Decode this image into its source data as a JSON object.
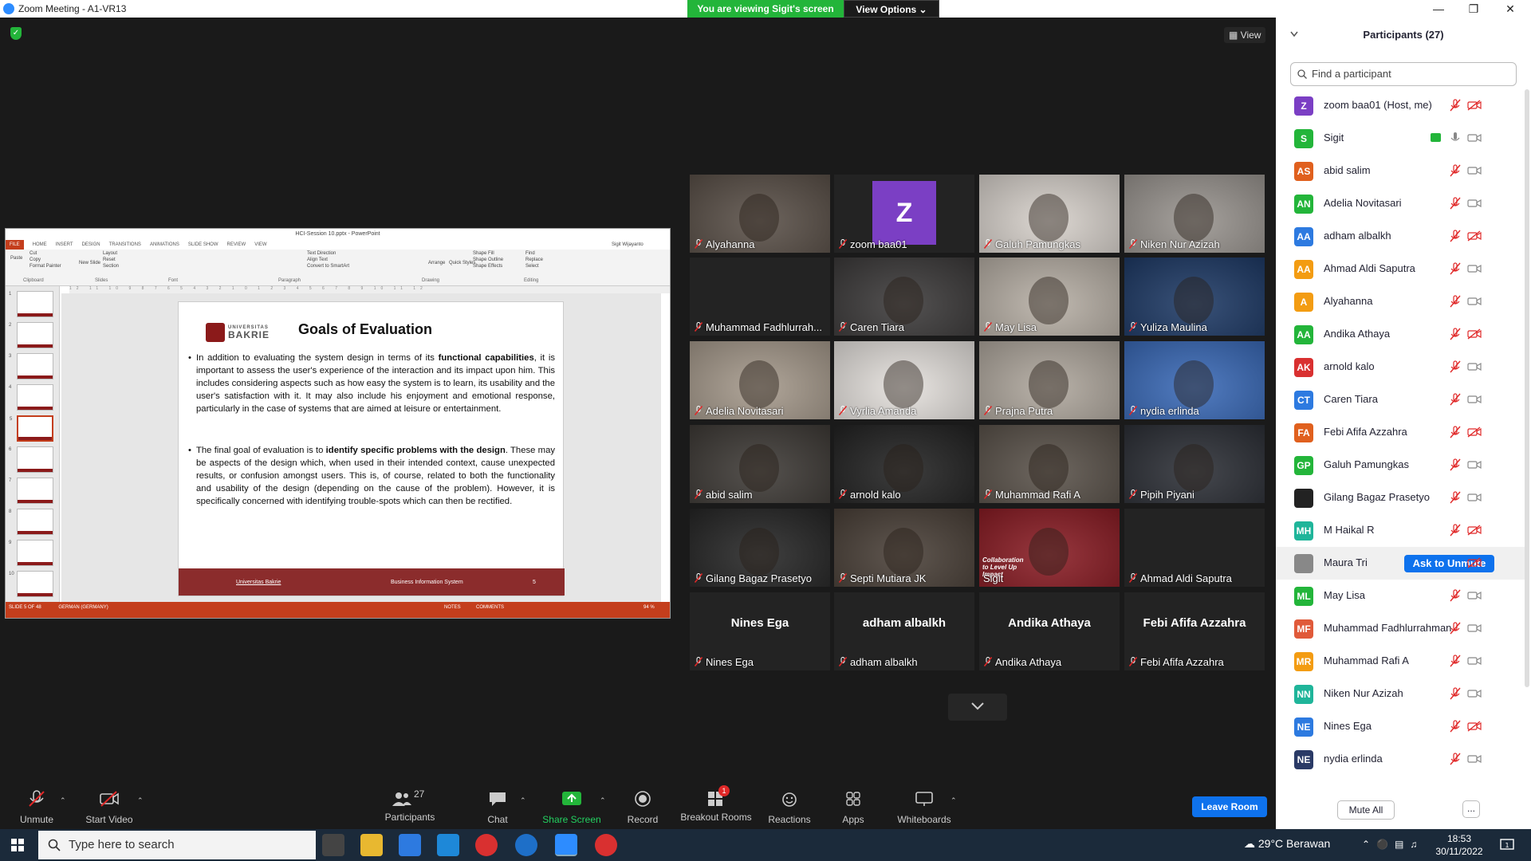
{
  "window": {
    "title": "Zoom Meeting - A1-VR13",
    "banner": "You are viewing Sigit's screen",
    "view_options": "View Options",
    "view_button": "View"
  },
  "ppt": {
    "window_title": "HCI-Session 10.pptx - PowerPoint",
    "tabs": [
      "FILE",
      "HOME",
      "INSERT",
      "DESIGN",
      "TRANSITIONS",
      "ANIMATIONS",
      "SLIDE SHOW",
      "REVIEW",
      "VIEW"
    ],
    "user": "Sigit Wijayanto",
    "ribbon_groups": [
      "Clipboard",
      "Slides",
      "Font",
      "Paragraph",
      "Drawing",
      "Editing"
    ],
    "ribbon_items": {
      "paste": "Paste",
      "cut": "Cut",
      "copy": "Copy",
      "format_painter": "Format Painter",
      "new_slide": "New Slide",
      "layout": "Layout",
      "reset": "Reset",
      "section": "Section",
      "text_direction": "Text Direction",
      "align_text": "Align Text",
      "smartart": "Convert to SmartArt",
      "arrange": "Arrange",
      "quick_styles": "Quick Styles",
      "shape_fill": "Shape Fill",
      "shape_outline": "Shape Outline",
      "shape_effects": "Shape Effects",
      "find": "Find",
      "replace": "Replace",
      "select": "Select"
    },
    "ruler": "12 11 10 9 8 7 6 5 4 3 2 1 0 1 2 3 4 5 6 7 8 9 10 11 12",
    "thumbs": [
      "1",
      "2",
      "3",
      "4",
      "5",
      "6",
      "7",
      "8",
      "9",
      "10"
    ],
    "selected_thumb": 5,
    "slide": {
      "logo_line1": "UNIVERSITAS",
      "logo_line2": "BAKRIE",
      "title": "Goals of Evaluation",
      "bullet1_a": "In addition to evaluating the system design in terms of its ",
      "bullet1_b": "functional capabilities",
      "bullet1_c": ", it is important to assess the user's experience of the interaction and its impact upon him. This includes considering aspects such as how easy the system is to learn, its usability and the user's satisfaction with it. It may also include his enjoyment and emotional response, particularly in the case of systems that are aimed at leisure or entertainment.",
      "bullet2_a": "The final goal of evaluation is to ",
      "bullet2_b": "identify specific problems with the design",
      "bullet2_c": ". These may be aspects of the design which, when used in their intended context, cause unexpected results, or confusion amongst users. This is, of course, related to both the functionality and usability of the design (depending on the cause of the problem). However, it is specifically concerned with identifying trouble-spots which can then be rectified.",
      "footer_left": "Universitas Bakrie",
      "footer_center": "Business Information System",
      "footer_right": "5"
    },
    "status_left": "SLIDE 5 OF 48",
    "status_lang": "GERMAN (GERMANY)",
    "status_notes": "NOTES",
    "status_comments": "COMMENTS",
    "zoom": "94 %"
  },
  "grid": [
    {
      "name": "Alyahanna",
      "muted": true,
      "kind": "cam",
      "bg": "#5a5048"
    },
    {
      "name": "zoom baa01",
      "muted": true,
      "kind": "avatar",
      "letter": "Z"
    },
    {
      "name": "Galuh Pamungkas",
      "muted": true,
      "kind": "cam",
      "bg": "#d8d2cc"
    },
    {
      "name": "Niken Nur Azizah",
      "muted": true,
      "kind": "cam",
      "bg": "#9a9590"
    },
    {
      "name": "Muhammad Fadhlurrah...",
      "muted": true,
      "kind": "off"
    },
    {
      "name": "Caren Tiara",
      "muted": true,
      "kind": "cam",
      "bg": "#3c3a3a"
    },
    {
      "name": "May Lisa",
      "muted": true,
      "kind": "cam",
      "bg": "#b8b0a6"
    },
    {
      "name": "Yuliza Maulina",
      "muted": true,
      "kind": "cam",
      "bg": "#1e3a66"
    },
    {
      "name": "Adelia Novitasari",
      "muted": true,
      "kind": "cam",
      "bg": "#a69a8c"
    },
    {
      "name": "Vyrlia Amanda",
      "muted": true,
      "kind": "cam",
      "bg": "#e6e2de"
    },
    {
      "name": "Prajna Putra",
      "muted": true,
      "kind": "cam",
      "bg": "#b0a89e"
    },
    {
      "name": "nydia erlinda",
      "muted": true,
      "kind": "cam",
      "bg": "#3a6ab8"
    },
    {
      "name": "abid salim",
      "muted": true,
      "kind": "cam",
      "bg": "#3e3a36"
    },
    {
      "name": "arnold kalo",
      "muted": true,
      "kind": "cam",
      "bg": "#222"
    },
    {
      "name": "Muhammad Rafi A",
      "muted": true,
      "kind": "cam",
      "bg": "#5a524a"
    },
    {
      "name": "Pipih Piyani",
      "muted": true,
      "kind": "cam",
      "bg": "#2c2f36"
    },
    {
      "name": "Gilang Bagaz Prasetyo",
      "muted": true,
      "kind": "cam",
      "bg": "#262626"
    },
    {
      "name": "Septi Mutiara JK",
      "muted": true,
      "kind": "cam",
      "bg": "#4a4038"
    },
    {
      "name": "Sigit",
      "muted": false,
      "kind": "cam",
      "bg": "#8a1c24",
      "active": true,
      "overlay": "Collaboration to Level Up Impact"
    },
    {
      "name": "Ahmad Aldi Saputra",
      "muted": true,
      "kind": "off"
    },
    {
      "name": "Nines Ega",
      "muted": true,
      "kind": "off",
      "big": "Nines Ega"
    },
    {
      "name": "adham albalkh",
      "muted": true,
      "kind": "off",
      "big": "adham albalkh"
    },
    {
      "name": "Andika Athaya",
      "muted": true,
      "kind": "off",
      "big": "Andika Athaya"
    },
    {
      "name": "Febi Afifa Azzahra",
      "muted": true,
      "kind": "off",
      "big": "Febi Afifa Azzahra"
    }
  ],
  "participants": {
    "title": "Participants (27)",
    "search_placeholder": "Find a participant",
    "list": [
      {
        "initials": "Z",
        "name": "zoom baa01 (Host, me)",
        "color": "#7b3fc4",
        "video_off": true
      },
      {
        "initials": "S",
        "name": "Sigit",
        "color": "#23b53a",
        "video_off": false,
        "sharing": true,
        "mic_on": true
      },
      {
        "initials": "AS",
        "name": "abid salim",
        "color": "#e0601e",
        "video_off": false
      },
      {
        "initials": "AN",
        "name": "Adelia Novitasari",
        "color": "#23b53a",
        "video_off": false
      },
      {
        "initials": "AA",
        "name": "adham albalkh",
        "color": "#2d7ae0",
        "video_off": true
      },
      {
        "initials": "AA",
        "name": "Ahmad Aldi Saputra",
        "color": "#f39c12",
        "video_off": false
      },
      {
        "initials": "A",
        "name": "Alyahanna",
        "color": "#f39c12",
        "video_off": false
      },
      {
        "initials": "AA",
        "name": "Andika Athaya",
        "color": "#23b53a",
        "video_off": true
      },
      {
        "initials": "AK",
        "name": "arnold kalo",
        "color": "#d93030",
        "video_off": false
      },
      {
        "initials": "CT",
        "name": "Caren Tiara",
        "color": "#2d7ae0",
        "video_off": false
      },
      {
        "initials": "FA",
        "name": "Febi Afifa Azzahra",
        "color": "#e0601e",
        "video_off": true
      },
      {
        "initials": "GP",
        "name": "Galuh Pamungkas",
        "color": "#23b53a",
        "video_off": false
      },
      {
        "initials": "",
        "name": "Gilang Bagaz Prasetyo",
        "color": "#222222",
        "video_off": false
      },
      {
        "initials": "MH",
        "name": "M Haikal R",
        "color": "#1fb59a",
        "video_off": true
      },
      {
        "initials": "",
        "name": "Maura Tri",
        "color": "#888888",
        "video_off": true,
        "ask": "Ask to Unmute"
      },
      {
        "initials": "ML",
        "name": "May Lisa",
        "color": "#23b53a",
        "video_off": false
      },
      {
        "initials": "MF",
        "name": "Muhammad Fadhlurrahman",
        "color": "#e05a3a",
        "video_off": false
      },
      {
        "initials": "MR",
        "name": "Muhammad Rafi A",
        "color": "#f39c12",
        "video_off": false
      },
      {
        "initials": "NN",
        "name": "Niken Nur Azizah",
        "color": "#1fb59a",
        "video_off": false
      },
      {
        "initials": "NE",
        "name": "Nines Ega",
        "color": "#2d7ae0",
        "video_off": true
      },
      {
        "initials": "NE",
        "name": "nydia erlinda",
        "color": "#2a3a66",
        "video_off": false
      }
    ],
    "mute_all": "Mute All",
    "more": "..."
  },
  "toolbar": {
    "unmute": "Unmute",
    "start_video": "Start Video",
    "participants": "Participants",
    "participants_count": "27",
    "chat": "Chat",
    "share": "Share Screen",
    "record": "Record",
    "breakout": "Breakout Rooms",
    "breakout_badge": "1",
    "reactions": "Reactions",
    "apps": "Apps",
    "whiteboards": "Whiteboards",
    "leave": "Leave Room"
  },
  "taskbar": {
    "search_placeholder": "Type here to search",
    "weather": "29°C  Berawan",
    "time": "18:53",
    "date": "30/11/2022",
    "notif_count": "1"
  },
  "colors": {
    "accent": "#0e72ed",
    "green": "#23b53a",
    "muted_red": "#e02828"
  }
}
